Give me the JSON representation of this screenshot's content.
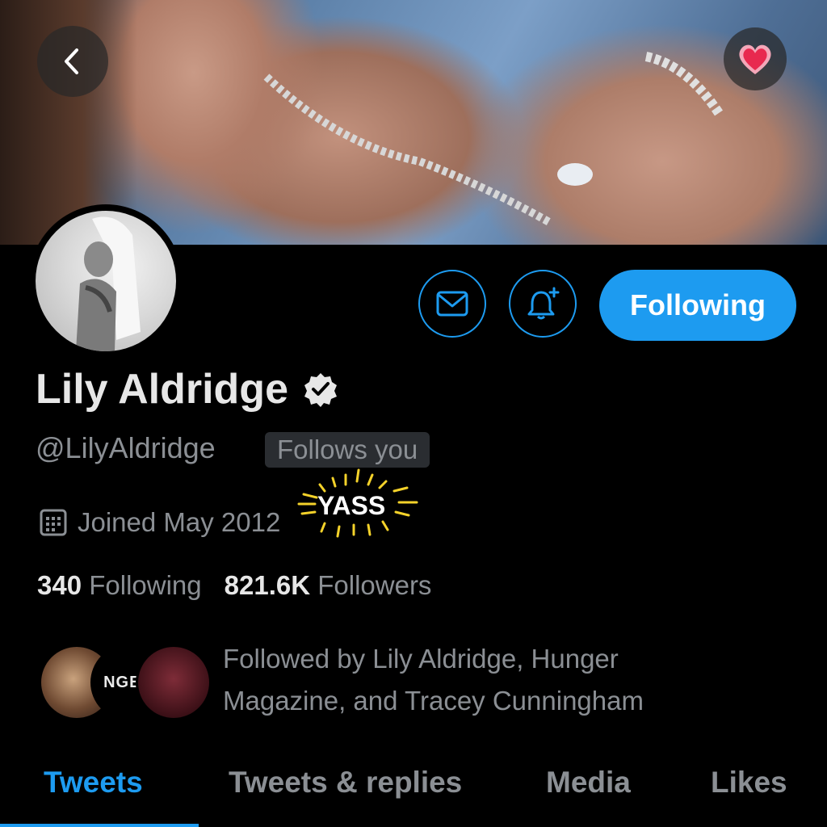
{
  "banner": {
    "description_icon": "banner-photo"
  },
  "nav": {
    "back_icon": "chevron-left-icon",
    "heart_icon": "heart-icon"
  },
  "avatar": {
    "icon": "profile-photo"
  },
  "actions": {
    "message_icon": "envelope-icon",
    "notify_icon": "bell-plus-icon",
    "follow_label": "Following"
  },
  "profile": {
    "name": "Lily Aldridge",
    "handle": "@LilyAldridge",
    "follows_you": "Follows you",
    "joined": "Joined May 2012",
    "sticker": "YASS"
  },
  "stats": {
    "following_count": "340",
    "following_label": "Following",
    "followers_count": "821.6K",
    "followers_label": "Followers"
  },
  "mutuals": {
    "logo_text": "NGER",
    "text_line1": "Followed by Lily Aldridge, Hunger",
    "text_line2": "Magazine, and Tracey Cunningham"
  },
  "tabs": [
    {
      "label": "Tweets",
      "active": true
    },
    {
      "label": "Tweets & replies",
      "active": false
    },
    {
      "label": "Media",
      "active": false
    },
    {
      "label": "Likes",
      "active": false
    }
  ],
  "colors": {
    "accent": "#1d9bf0",
    "muted": "#8b8f94",
    "background": "#000000",
    "heart": "#e8294f"
  }
}
